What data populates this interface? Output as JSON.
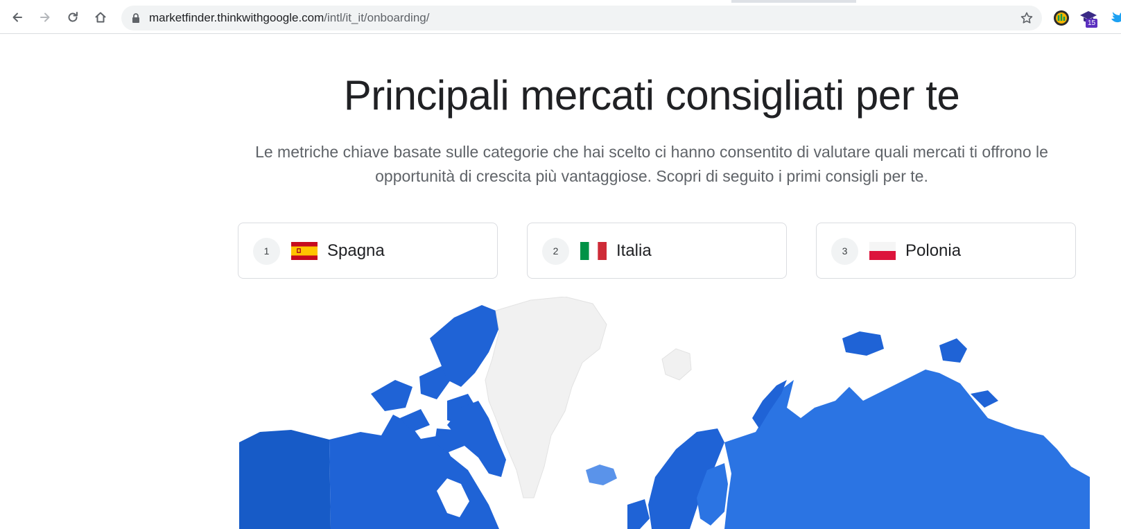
{
  "browser": {
    "url_host": "marketfinder.thinkwithgoogle.com",
    "url_path": "/intl/it_it/onboarding/",
    "extension_badge": "15",
    "colors": {
      "toolbar": "#ffffff",
      "omnibox": "#f1f3f4",
      "icon": "#5f6368"
    }
  },
  "page": {
    "title": "Principali mercati consigliati per te",
    "subtitle": "Le metriche chiave basate sulle categorie che hai scelto ci hanno consentito di valutare quali mercati ti offrono le opportunità di crescita più vantaggiose. Scopri di seguito i primi consigli per te.",
    "markets": [
      {
        "rank": "1",
        "name": "Spagna",
        "flag": "spain-flag"
      },
      {
        "rank": "2",
        "name": "Italia",
        "flag": "italy-flag"
      },
      {
        "rank": "3",
        "name": "Polonia",
        "flag": "poland-flag"
      }
    ],
    "map": {
      "colors": {
        "recommended": "#1f63d6",
        "highlight": "#2b74e3",
        "dark": "#175bc7",
        "light_blue": "#5a93ea",
        "not_recommended": "#f1f1f1"
      }
    }
  }
}
